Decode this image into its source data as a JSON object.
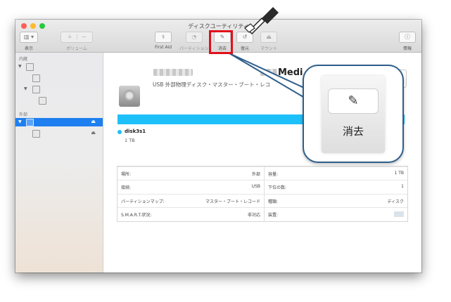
{
  "window": {
    "title": "ディスクユーティリティ"
  },
  "toolbar": {
    "view_label": "表示",
    "volume_label": "ボリューム",
    "firstaid_label": "First Aid",
    "partition_label": "パーティション",
    "erase_label": "消去",
    "restore_label": "復元",
    "mount_label": "マウント",
    "info_label": "情報"
  },
  "sidebar": {
    "internal_header": "内蔵",
    "external_header": "外部"
  },
  "disk": {
    "title": "Medi",
    "description": "USB 外部物理ディスク・マスター・ブート・レコ"
  },
  "volume": {
    "name": "disk3s1",
    "size": "1 TB"
  },
  "info": {
    "left": [
      {
        "key": "場所:",
        "value": "外部"
      },
      {
        "key": "接続:",
        "value": "USB"
      },
      {
        "key": "パーティションマップ:",
        "value": "マスター・ブート・レコード"
      },
      {
        "key": "S.M.A.R.T.状況:",
        "value": "非対応"
      }
    ],
    "right": [
      {
        "key": "容量:",
        "value": "1 TB"
      },
      {
        "key": "下位の数:",
        "value": "1"
      },
      {
        "key": "種類:",
        "value": "ディスク"
      },
      {
        "key": "装置:",
        "value": ""
      }
    ]
  },
  "callout": {
    "label": "消去"
  },
  "colors": {
    "accent": "#1e7ff0",
    "usage_bar": "#1ec0f9",
    "highlight": "#e0101a",
    "callout_border": "#2f5f8c"
  }
}
